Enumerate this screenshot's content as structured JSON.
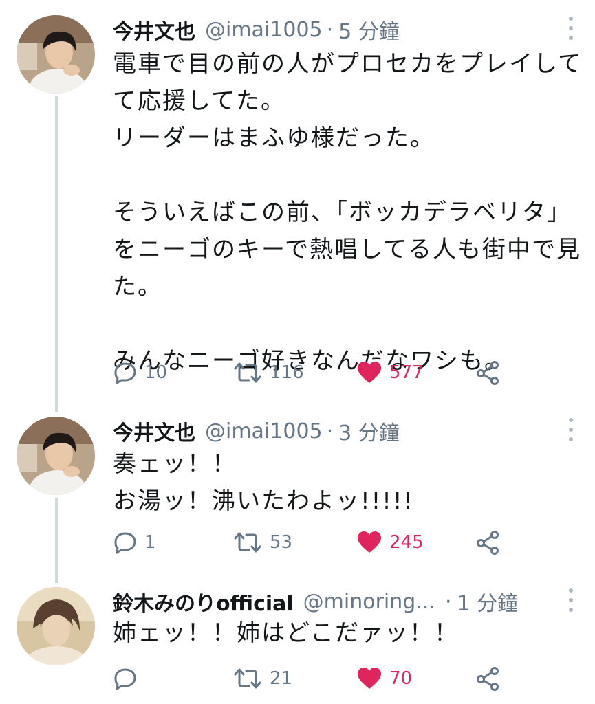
{
  "tweets": [
    {
      "name": "今井文也",
      "handle": "@imai1005",
      "separator": "·",
      "time": "5 分鐘",
      "lines": [
        "電車で目の前の人がプロセカをプレイして",
        "て応援してた。",
        "リーダーはまふゆ様だった。",
        "",
        "そういえばこの前、「ボッカデラベリタ」",
        "をニーゴのキーで熱唱してる人も街中で見",
        "た。",
        "",
        "みんなニーゴ好きなんだなワシも。"
      ],
      "replies": "10",
      "retweets": "116",
      "likes": "577",
      "liked": true
    },
    {
      "name": "今井文也",
      "handle": "@imai1005",
      "separator": "·",
      "time": "3 分鐘",
      "lines": [
        "奏ェッ！！",
        "お湯ッ！沸いたわよッ!!!!!"
      ],
      "replies": "1",
      "retweets": "53",
      "likes": "245",
      "liked": true
    },
    {
      "name": "鈴木みのりofficial",
      "handle": "@minoring...",
      "separator": "·",
      "time": "1 分鐘",
      "lines": [
        "姉ェッ！！姉はどこだァッ！！"
      ],
      "replies": "",
      "retweets": "21",
      "likes": "70",
      "liked": true
    }
  ],
  "colors": {
    "text": "#14171a",
    "secondary": "#657786",
    "like": "#e0245e",
    "thread_line": "#cfd9de",
    "background": "#ffffff"
  },
  "icons": [
    "avatar",
    "more-vertical-icon",
    "reply-icon",
    "retweet-icon",
    "heart-icon",
    "share-icon"
  ]
}
